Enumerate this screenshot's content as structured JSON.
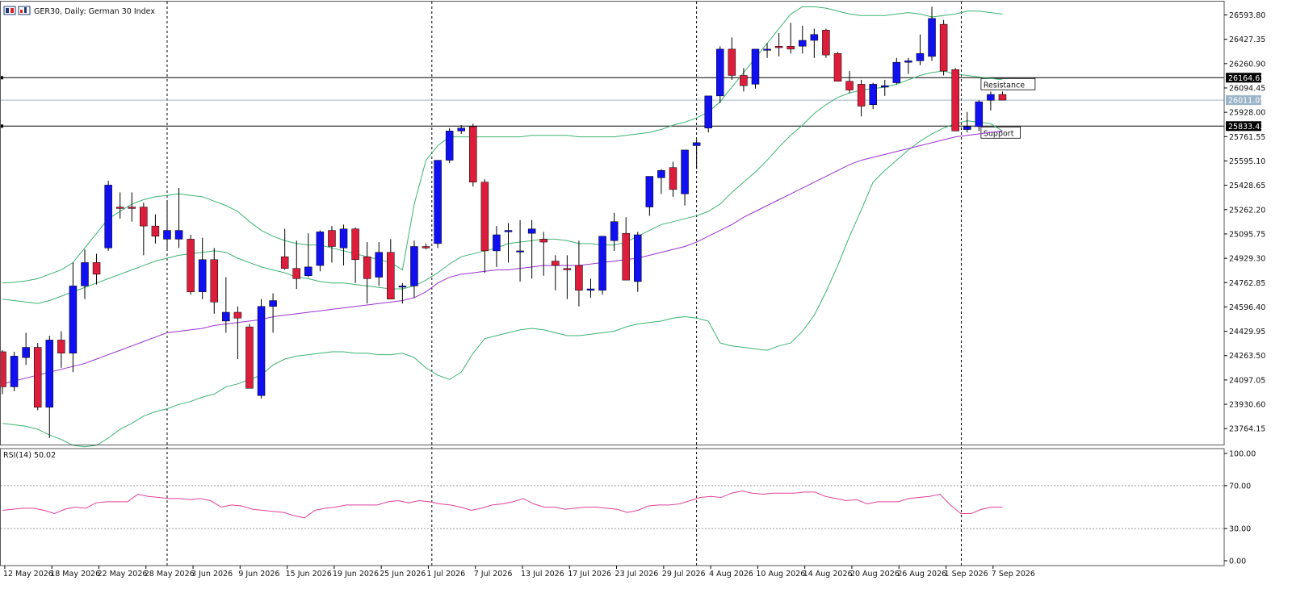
{
  "header": {
    "symbol": "GER30",
    "timeframe": "Daily",
    "description": "German 30 Index",
    "title": "GER30, Daily:  German 30 Index"
  },
  "colors": {
    "bull": "#1010f0",
    "bear": "#dc1e3c",
    "bollinger": "#3cb371",
    "ma": "#9b30d0",
    "rsi": "#e0409a",
    "level_line": "#000000",
    "price_line": "#9bb4c8"
  },
  "chart_data": [
    {
      "type": "candlestick",
      "title": "",
      "x_tick_labels": [
        "12 May 2026",
        "18 May 2026",
        "22 May 2026",
        "28 May 2026",
        "3 Jun 2026",
        "9 Jun 2026",
        "15 Jun 2026",
        "19 Jun 2026",
        "25 Jun 2026",
        "1 Jul 2026",
        "7 Jul 2026",
        "13 Jul 2026",
        "17 Jul 2026",
        "23 Jul 2026",
        "29 Jul 2026",
        "4 Aug 2026",
        "10 Aug 2026",
        "14 Aug 2026",
        "20 Aug 2026",
        "26 Aug 2026",
        "1 Sep 2026",
        "7 Sep 2026"
      ],
      "y_tick_labels": [
        "26593.80",
        "26427.35",
        "26260.90",
        "26094.45",
        "25928.00",
        "25761.55",
        "25595.10",
        "25428.65",
        "25262.20",
        "25095.75",
        "24929.30",
        "24762.85",
        "24596.40",
        "24429.95",
        "24263.50",
        "24097.05",
        "23930.60",
        "23764.15"
      ],
      "ylim": [
        23655,
        26685
      ],
      "levels": [
        {
          "name": "Resistance",
          "value": 26164.63,
          "label": "26164.63"
        },
        {
          "name": "Support",
          "value": 25833.43,
          "label": "25833.43"
        }
      ],
      "current_price": {
        "value": 26011.05,
        "label": "26011.05"
      },
      "candles": [
        {
          "o": 24290,
          "h": 24300,
          "l": 24000,
          "c": 24050
        },
        {
          "o": 24050,
          "h": 24290,
          "l": 24020,
          "c": 24260
        },
        {
          "o": 24250,
          "h": 24420,
          "l": 24200,
          "c": 24320
        },
        {
          "o": 24320,
          "h": 24350,
          "l": 23890,
          "c": 23910
        },
        {
          "o": 23910,
          "h": 24400,
          "l": 23700,
          "c": 24370
        },
        {
          "o": 24370,
          "h": 24430,
          "l": 24180,
          "c": 24280
        },
        {
          "o": 24280,
          "h": 24900,
          "l": 24150,
          "c": 24740
        },
        {
          "o": 24740,
          "h": 24990,
          "l": 24650,
          "c": 24900
        },
        {
          "o": 24900,
          "h": 24960,
          "l": 24750,
          "c": 24820
        },
        {
          "o": 25000,
          "h": 25460,
          "l": 24980,
          "c": 25430
        },
        {
          "o": 25280,
          "h": 25380,
          "l": 25200,
          "c": 25270
        },
        {
          "o": 25280,
          "h": 25380,
          "l": 25180,
          "c": 25270
        },
        {
          "o": 25280,
          "h": 25310,
          "l": 24950,
          "c": 25150
        },
        {
          "o": 25150,
          "h": 25230,
          "l": 25030,
          "c": 25080
        },
        {
          "o": 25060,
          "h": 25320,
          "l": 24980,
          "c": 25120
        },
        {
          "o": 25060,
          "h": 25410,
          "l": 25000,
          "c": 25120
        },
        {
          "o": 25060,
          "h": 25090,
          "l": 24680,
          "c": 24700
        },
        {
          "o": 24700,
          "h": 25070,
          "l": 24650,
          "c": 24920
        },
        {
          "o": 24920,
          "h": 25000,
          "l": 24550,
          "c": 24630
        },
        {
          "o": 24500,
          "h": 24800,
          "l": 24420,
          "c": 24560
        },
        {
          "o": 24560,
          "h": 24600,
          "l": 24240,
          "c": 24520
        },
        {
          "o": 24460,
          "h": 24480,
          "l": 24040,
          "c": 24040
        },
        {
          "o": 23990,
          "h": 24650,
          "l": 23970,
          "c": 24600
        },
        {
          "o": 24600,
          "h": 24690,
          "l": 24420,
          "c": 24640
        },
        {
          "o": 24940,
          "h": 25130,
          "l": 24850,
          "c": 24860
        },
        {
          "o": 24860,
          "h": 25050,
          "l": 24720,
          "c": 24790
        },
        {
          "o": 24810,
          "h": 25100,
          "l": 24800,
          "c": 24870
        },
        {
          "o": 24880,
          "h": 25120,
          "l": 24840,
          "c": 25110
        },
        {
          "o": 25120,
          "h": 25150,
          "l": 24900,
          "c": 25010
        },
        {
          "o": 25000,
          "h": 25160,
          "l": 24880,
          "c": 25130
        },
        {
          "o": 25130,
          "h": 25140,
          "l": 24760,
          "c": 24920
        },
        {
          "o": 24940,
          "h": 25040,
          "l": 24620,
          "c": 24790
        },
        {
          "o": 24800,
          "h": 25040,
          "l": 24740,
          "c": 24970
        },
        {
          "o": 24970,
          "h": 25060,
          "l": 24650,
          "c": 24650
        },
        {
          "o": 24740,
          "h": 24760,
          "l": 24620,
          "c": 24740
        },
        {
          "o": 24740,
          "h": 25050,
          "l": 24660,
          "c": 25010
        },
        {
          "o": 25010,
          "h": 25030,
          "l": 24990,
          "c": 25000
        },
        {
          "o": 25030,
          "h": 25580,
          "l": 25000,
          "c": 25600
        },
        {
          "o": 25600,
          "h": 25820,
          "l": 25580,
          "c": 25800
        },
        {
          "o": 25800,
          "h": 25840,
          "l": 25780,
          "c": 25820
        },
        {
          "o": 25830,
          "h": 25850,
          "l": 25420,
          "c": 25450
        },
        {
          "o": 25450,
          "h": 25470,
          "l": 24830,
          "c": 24980
        },
        {
          "o": 24980,
          "h": 25150,
          "l": 24870,
          "c": 25090
        },
        {
          "o": 25110,
          "h": 25170,
          "l": 24900,
          "c": 25120
        },
        {
          "o": 24980,
          "h": 25190,
          "l": 24770,
          "c": 24980
        },
        {
          "o": 25100,
          "h": 25190,
          "l": 24790,
          "c": 25130
        },
        {
          "o": 25060,
          "h": 25110,
          "l": 24810,
          "c": 25040
        },
        {
          "o": 24910,
          "h": 24950,
          "l": 24710,
          "c": 24880
        },
        {
          "o": 24860,
          "h": 24950,
          "l": 24650,
          "c": 24850
        },
        {
          "o": 24880,
          "h": 25050,
          "l": 24600,
          "c": 24710
        },
        {
          "o": 24710,
          "h": 24790,
          "l": 24660,
          "c": 24720
        },
        {
          "o": 24710,
          "h": 25080,
          "l": 24680,
          "c": 25080
        },
        {
          "o": 25050,
          "h": 25240,
          "l": 24980,
          "c": 25180
        },
        {
          "o": 25100,
          "h": 25210,
          "l": 24950,
          "c": 24780
        },
        {
          "o": 24770,
          "h": 25110,
          "l": 24700,
          "c": 25090
        },
        {
          "o": 25280,
          "h": 25440,
          "l": 25220,
          "c": 25490
        },
        {
          "o": 25480,
          "h": 25540,
          "l": 25370,
          "c": 25530
        },
        {
          "o": 25550,
          "h": 25590,
          "l": 25350,
          "c": 25400
        },
        {
          "o": 25370,
          "h": 25660,
          "l": 25290,
          "c": 25670
        },
        {
          "o": 25700,
          "h": 25740,
          "l": 25540,
          "c": 25720
        },
        {
          "o": 25820,
          "h": 26020,
          "l": 25790,
          "c": 26040
        },
        {
          "o": 26040,
          "h": 26380,
          "l": 25990,
          "c": 26360
        },
        {
          "o": 26360,
          "h": 26440,
          "l": 26150,
          "c": 26180
        },
        {
          "o": 26180,
          "h": 26230,
          "l": 26070,
          "c": 26110
        },
        {
          "o": 26120,
          "h": 26330,
          "l": 26090,
          "c": 26360
        },
        {
          "o": 26360,
          "h": 26400,
          "l": 26300,
          "c": 26360
        },
        {
          "o": 26380,
          "h": 26470,
          "l": 26310,
          "c": 26370
        },
        {
          "o": 26380,
          "h": 26540,
          "l": 26330,
          "c": 26360
        },
        {
          "o": 26380,
          "h": 26520,
          "l": 26330,
          "c": 26420
        },
        {
          "o": 26420,
          "h": 26500,
          "l": 26300,
          "c": 26460
        },
        {
          "o": 26490,
          "h": 26500,
          "l": 26300,
          "c": 26320
        },
        {
          "o": 26330,
          "h": 26340,
          "l": 26140,
          "c": 26140
        },
        {
          "o": 26140,
          "h": 26210,
          "l": 26060,
          "c": 26080
        },
        {
          "o": 26120,
          "h": 26150,
          "l": 25900,
          "c": 25970
        },
        {
          "o": 25980,
          "h": 26130,
          "l": 25950,
          "c": 26120
        },
        {
          "o": 26100,
          "h": 26150,
          "l": 26040,
          "c": 26110
        },
        {
          "o": 26130,
          "h": 26300,
          "l": 26120,
          "c": 26270
        },
        {
          "o": 26270,
          "h": 26300,
          "l": 26190,
          "c": 26280
        },
        {
          "o": 26280,
          "h": 26460,
          "l": 26250,
          "c": 26330
        },
        {
          "o": 26310,
          "h": 26650,
          "l": 26280,
          "c": 26570
        },
        {
          "o": 26530,
          "h": 26560,
          "l": 26180,
          "c": 26210
        },
        {
          "o": 26220,
          "h": 26230,
          "l": 25800,
          "c": 25800
        },
        {
          "o": 25810,
          "h": 25930,
          "l": 25790,
          "c": 25830
        },
        {
          "o": 25830,
          "h": 26010,
          "l": 25800,
          "c": 26000
        },
        {
          "o": 26010,
          "h": 26070,
          "l": 25940,
          "c": 26050
        },
        {
          "o": 26050,
          "h": 26070,
          "l": 26010,
          "c": 26011
        }
      ],
      "bollinger_upper": [
        24760,
        24765,
        24775,
        24790,
        24820,
        24850,
        24900,
        25000,
        25100,
        25200,
        25250,
        25300,
        25330,
        25350,
        25360,
        25370,
        25360,
        25350,
        25320,
        25290,
        25250,
        25180,
        25120,
        25080,
        25050,
        25030,
        25020,
        25020,
        25000,
        24980,
        24960,
        24940,
        24920,
        24900,
        24850,
        25300,
        25600,
        25700,
        25760,
        25760,
        25760,
        25760,
        25760,
        25760,
        25760,
        25770,
        25770,
        25770,
        25770,
        25760,
        25760,
        25760,
        25760,
        25770,
        25780,
        25790,
        25810,
        25840,
        25860,
        25890,
        25930,
        26000,
        26100,
        26200,
        26300,
        26400,
        26500,
        26600,
        26650,
        26650,
        26640,
        26620,
        26600,
        26590,
        26590,
        26590,
        26600,
        26610,
        26600,
        26580,
        26590,
        26600,
        26620,
        26620,
        26610,
        26600
      ],
      "bollinger_mid": [
        24650,
        24640,
        24630,
        24620,
        24640,
        24670,
        24700,
        24730,
        24760,
        24790,
        24820,
        24850,
        24880,
        24910,
        24930,
        24950,
        24960,
        24970,
        24980,
        24970,
        24930,
        24900,
        24870,
        24850,
        24830,
        24800,
        24790,
        24770,
        24760,
        24760,
        24750,
        24740,
        24730,
        24720,
        24720,
        24740,
        24780,
        24830,
        24890,
        24940,
        24960,
        24980,
        25000,
        25030,
        25040,
        25050,
        25060,
        25060,
        25050,
        25030,
        25030,
        25020,
        25020,
        25040,
        25080,
        25120,
        25160,
        25180,
        25200,
        25220,
        25250,
        25300,
        25380,
        25450,
        25520,
        25600,
        25690,
        25770,
        25840,
        25920,
        25980,
        26030,
        26060,
        26080,
        26090,
        26100,
        26120,
        26150,
        26180,
        26200,
        26210,
        26190,
        26180,
        26170,
        26160,
        26150
      ],
      "bollinger_lower": [
        23800,
        23790,
        23780,
        23760,
        23720,
        23690,
        23650,
        23640,
        23650,
        23700,
        23760,
        23800,
        23850,
        23880,
        23900,
        23930,
        23950,
        23980,
        24000,
        24050,
        24070,
        24100,
        24130,
        24200,
        24240,
        24260,
        24270,
        24280,
        24290,
        24290,
        24280,
        24280,
        24270,
        24270,
        24280,
        24250,
        24180,
        24130,
        24100,
        24150,
        24280,
        24380,
        24400,
        24420,
        24440,
        24450,
        24440,
        24420,
        24400,
        24400,
        24410,
        24420,
        24430,
        24460,
        24480,
        24490,
        24500,
        24520,
        24530,
        24520,
        24500,
        24350,
        24330,
        24320,
        24310,
        24300,
        24330,
        24350,
        24430,
        24540,
        24700,
        24880,
        25080,
        25260,
        25450,
        25530,
        25600,
        25670,
        25730,
        25780,
        25820,
        25850,
        25870,
        25860,
        25850,
        25800
      ],
      "ma": [
        24070,
        24090,
        24110,
        24130,
        24150,
        24170,
        24190,
        24210,
        24240,
        24270,
        24300,
        24330,
        24360,
        24390,
        24420,
        24430,
        24440,
        24450,
        24470,
        24480,
        24490,
        24500,
        24510,
        24530,
        24540,
        24550,
        24560,
        24570,
        24580,
        24590,
        24600,
        24610,
        24620,
        24630,
        24640,
        24660,
        24700,
        24760,
        24800,
        24820,
        24830,
        24840,
        24850,
        24850,
        24860,
        24870,
        24880,
        24880,
        24880,
        24880,
        24890,
        24900,
        24910,
        24920,
        24930,
        24950,
        24970,
        24990,
        25010,
        25040,
        25080,
        25120,
        25160,
        25210,
        25250,
        25290,
        25330,
        25370,
        25410,
        25450,
        25490,
        25530,
        25570,
        25600,
        25620,
        25640,
        25660,
        25680,
        25700,
        25720,
        25740,
        25760,
        25770,
        25780,
        25790,
        25800
      ]
    },
    {
      "type": "line",
      "title": "RSI(14) 50.02",
      "y_tick_labels": [
        "100.00",
        "70.00",
        "30.00",
        "0.00"
      ],
      "ylim": [
        0,
        100
      ],
      "levels": [
        70,
        30
      ],
      "values": [
        47,
        48,
        49,
        49,
        47,
        44,
        48,
        50,
        49,
        54,
        55,
        55,
        55,
        62,
        60,
        59,
        58,
        58,
        57,
        58,
        56,
        50,
        52,
        51,
        48,
        47,
        46,
        45,
        42,
        40,
        47,
        49,
        50,
        52,
        52,
        52,
        52,
        55,
        56,
        54,
        56,
        55,
        53,
        52,
        50,
        47,
        49,
        52,
        53,
        55,
        58,
        53,
        50,
        50,
        48,
        49,
        50,
        50,
        49,
        48,
        45,
        47,
        51,
        52,
        52,
        53,
        56,
        59,
        60,
        59,
        63,
        65,
        63,
        62,
        63,
        63,
        63,
        64,
        64,
        60,
        58,
        56,
        57,
        53,
        55,
        55,
        55,
        58,
        59,
        60,
        62,
        52,
        44,
        44,
        48,
        50,
        50
      ]
    }
  ]
}
